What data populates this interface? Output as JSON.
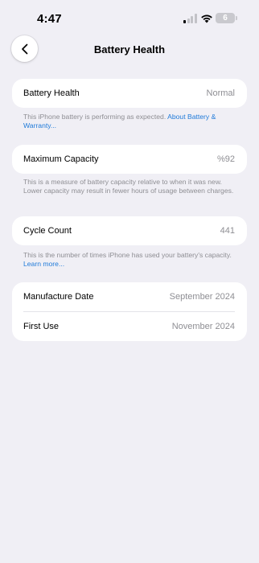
{
  "status_bar": {
    "time": "4:47",
    "battery_level": "6",
    "signal_bars_active": 1,
    "signal_bars_total": 4
  },
  "nav": {
    "title": "Battery Health",
    "back_icon": "chevron-left-icon"
  },
  "battery_health": {
    "label": "Battery Health",
    "value": "Normal",
    "footnote": "This iPhone battery is performing as expected. ",
    "footnote_link": "About Battery & Warranty..."
  },
  "maximum_capacity": {
    "label": "Maximum Capacity",
    "value": "%92",
    "footnote": "This is a measure of battery capacity relative to when it was new. Lower capacity may result in fewer hours of usage between charges."
  },
  "cycle_count": {
    "label": "Cycle Count",
    "value": "441",
    "footnote": "This is the number of times iPhone has used your battery's capacity. ",
    "footnote_link": "Learn more..."
  },
  "dates": {
    "manufacture_label": "Manufacture Date",
    "manufacture_value": "September 2024",
    "first_use_label": "First Use",
    "first_use_value": "November 2024"
  },
  "colors": {
    "background": "#f0eff5",
    "link": "#1f7ad9",
    "secondary_text": "#8e8e93"
  }
}
